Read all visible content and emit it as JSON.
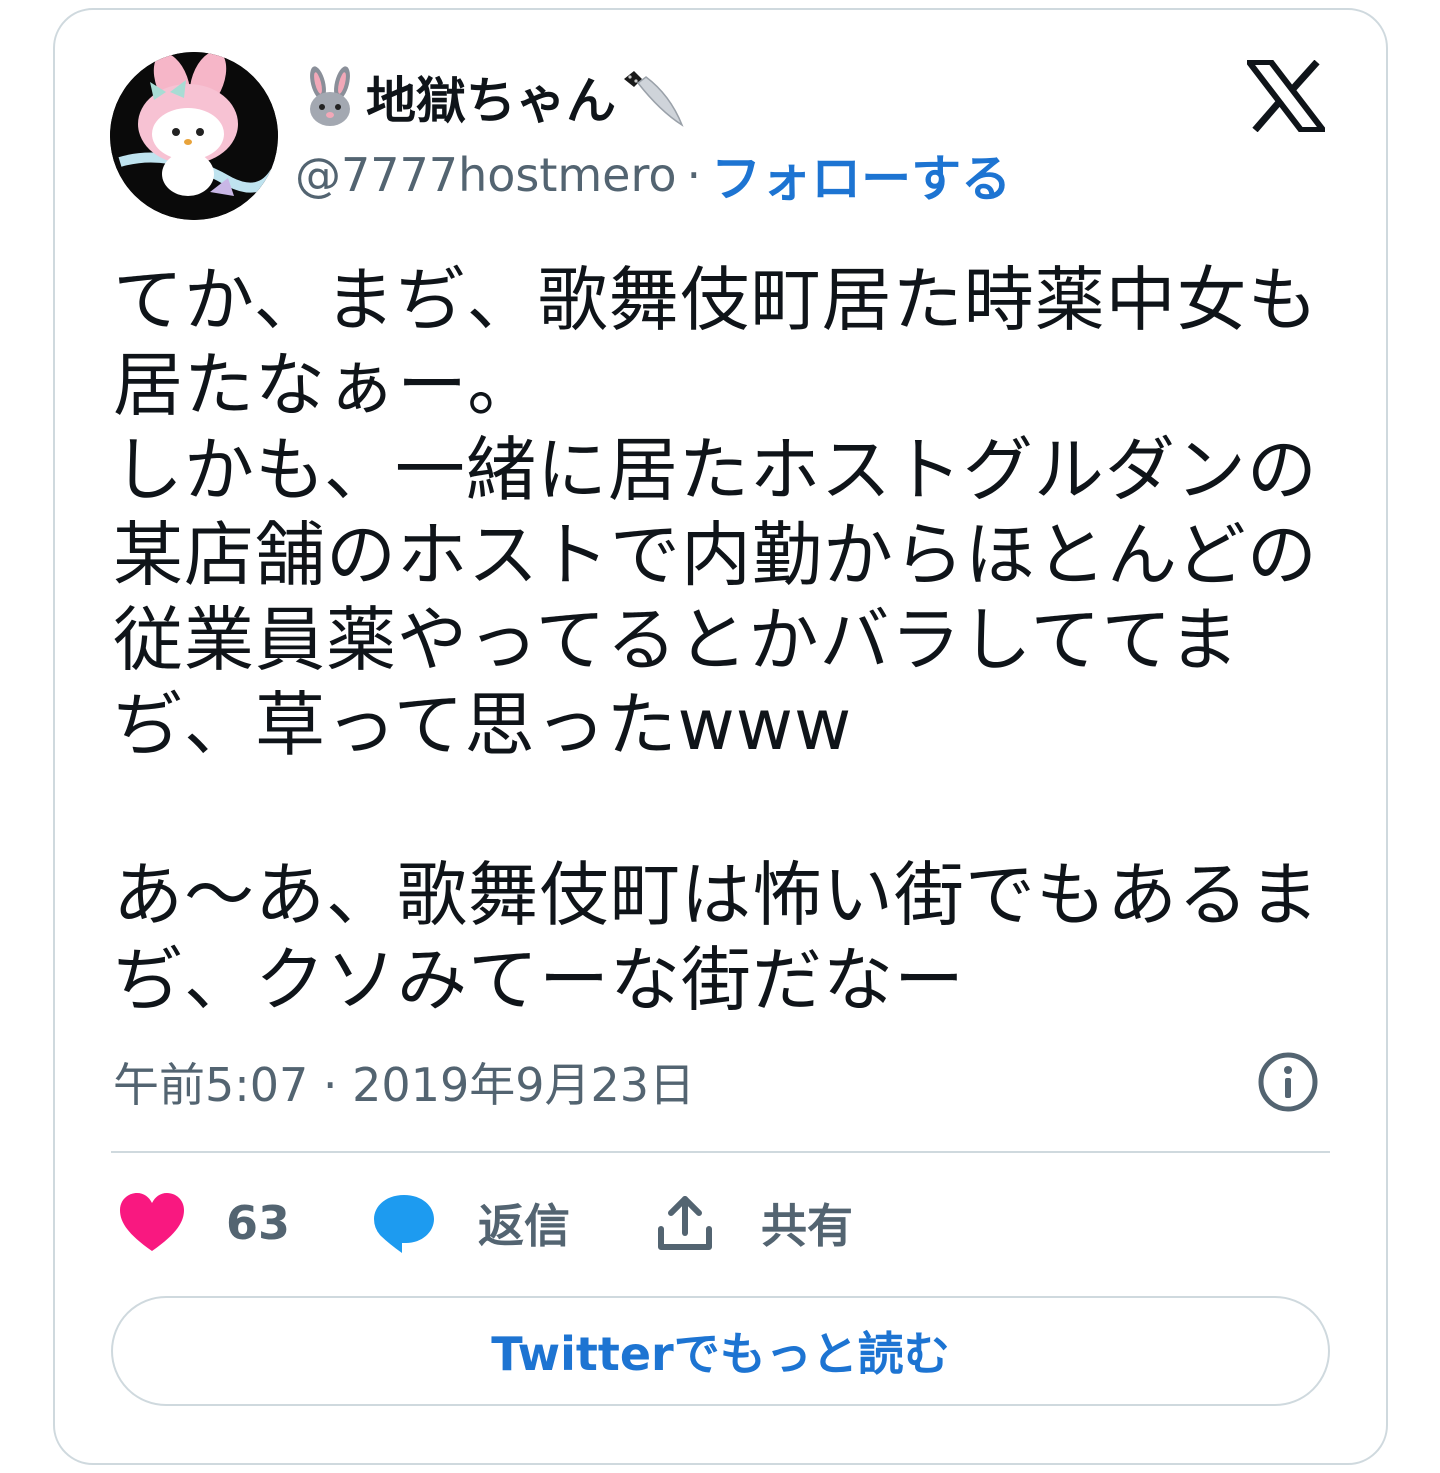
{
  "tweet": {
    "display_name": "地獄ちゃん",
    "handle": "@7777hostmero",
    "separator": "·",
    "follow_label": "フォローする",
    "text": "てか、まぢ、歌舞伎町居た時薬中女も\n居たなぁー。\nしかも、一緒に居たホストグルダンの\n某店舗のホストで内勤からほとんどの\n従業員薬やってるとかバラしててま\nぢ、草って思ったwww\n\nあ〜あ、歌舞伎町は怖い街でもあるま\nぢ、クソみてーな街だなー",
    "timestamp": "午前5:07 · 2019年9月23日"
  },
  "actions": {
    "like_count": "63",
    "reply_label": "返信",
    "share_label": "共有"
  },
  "read_more_label": "Twitterでもっと読む",
  "icons": {
    "name_prefix": "rabbit-icon",
    "name_suffix": "knife-icon",
    "brand": "x-logo-icon",
    "info": "info-icon",
    "like": "heart-icon",
    "reply": "speech-bubble-icon",
    "share": "share-upload-icon"
  },
  "colors": {
    "text": "#0f1419",
    "secondary": "#536471",
    "link": "#1d74d2",
    "heart": "#f91880",
    "reply_bubble": "#1d9bf0",
    "border": "#cfd9de"
  }
}
